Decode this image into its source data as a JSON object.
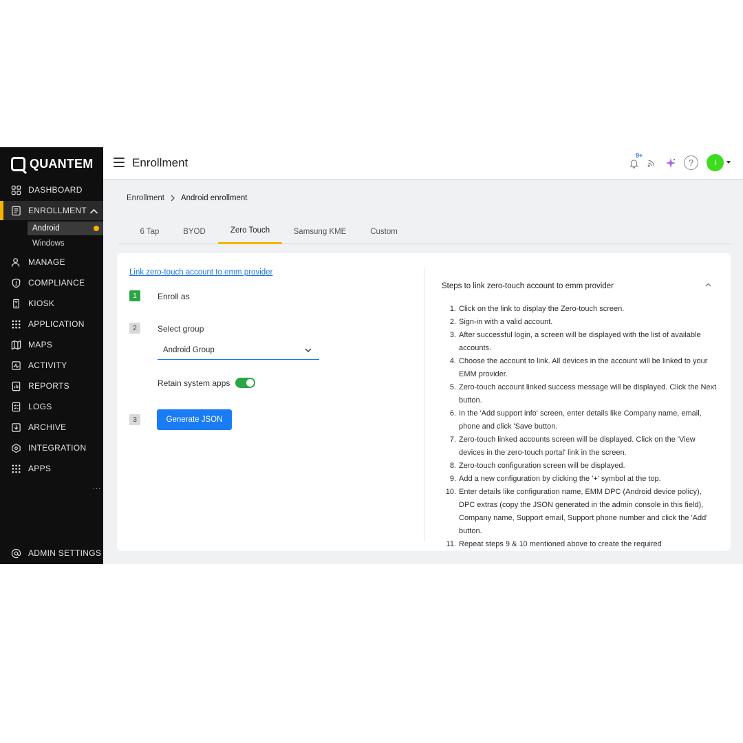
{
  "brand": {
    "name": "QUANTEM"
  },
  "sidebar": {
    "items": [
      {
        "label": "DASHBOARD",
        "icon": "grid-icon"
      },
      {
        "label": "ENROLLMENT",
        "icon": "clipboard-icon"
      },
      {
        "label": "MANAGE",
        "icon": "user-icon"
      },
      {
        "label": "COMPLIANCE",
        "icon": "shield-icon"
      },
      {
        "label": "KIOSK",
        "icon": "kiosk-icon"
      },
      {
        "label": "APPLICATION",
        "icon": "apps-grid-icon"
      },
      {
        "label": "MAPS",
        "icon": "map-icon"
      },
      {
        "label": "ACTIVITY",
        "icon": "activity-icon"
      },
      {
        "label": "REPORTS",
        "icon": "reports-icon"
      },
      {
        "label": "LOGS",
        "icon": "logs-icon"
      },
      {
        "label": "ARCHIVE",
        "icon": "archive-icon"
      },
      {
        "label": "INTEGRATION",
        "icon": "integration-icon"
      },
      {
        "label": "APPS",
        "icon": "apps-icon"
      }
    ],
    "sub_items": [
      "Android",
      "Windows"
    ],
    "more": "...",
    "footer": {
      "label": "ADMIN SETTINGS",
      "icon": "at-icon"
    },
    "accent_color": "#f5b400"
  },
  "header": {
    "title": "Enrollment",
    "notification_badge": "9+",
    "avatar_initial": "I",
    "help_symbol": "?"
  },
  "breadcrumb": {
    "parent": "Enrollment",
    "current": "Android enrollment"
  },
  "tabs": [
    "6 Tap",
    "BYOD",
    "Zero Touch",
    "Samsung KME",
    "Custom"
  ],
  "active_tab": "Zero Touch",
  "form": {
    "link_text": "Link zero-touch account to emm provider",
    "step1": {
      "num": "1",
      "label": "Enroll as"
    },
    "step2": {
      "num": "2",
      "label": "Select group",
      "selected": "Android Group"
    },
    "retain": {
      "label": "Retain system apps",
      "on": true
    },
    "step3": {
      "num": "3",
      "button": "Generate JSON"
    }
  },
  "instructions": {
    "title": "Steps to link zero-touch account to emm provider",
    "steps": [
      "Click on the link to display the Zero-touch screen.",
      "Sign-in with a valid account.",
      "After successful login, a screen will be displayed with the list of available accounts.",
      "Choose the account to link. All devices in the account will be linked to your EMM provider.",
      "Zero-touch account linked success message will be displayed. Click the Next button.",
      "In the 'Add support info' screen, enter details like Company name, email, phone and click 'Save button.",
      "Zero-touch linked accounts screen will be displayed. Click on the 'View devices in the zero-touch portal' link in the screen.",
      "Zero-touch configuration screen will be displayed.",
      "Add a new configuration by clicking the '+' symbol at the top.",
      "Enter details like configuration name, EMM DPC (Android device policy), DPC extras (copy the JSON generated in the admin console in this field), Company name, Support email, Support phone number and click the 'Add' button.",
      "Repeat steps 9 & 10 mentioned above to create the required"
    ]
  },
  "colors": {
    "primary": "#1a7cf5",
    "success": "#28a745",
    "avatar": "#3ddc1f"
  }
}
